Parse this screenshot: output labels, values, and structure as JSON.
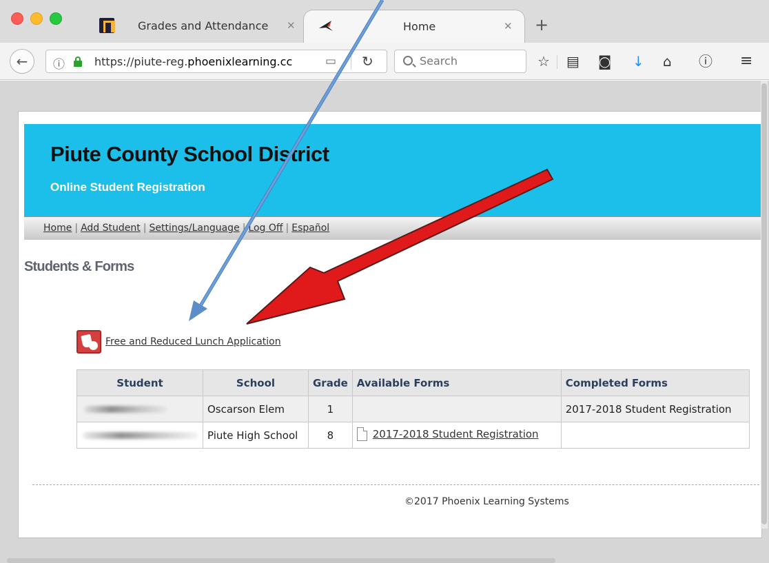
{
  "browser": {
    "tabs": [
      {
        "title": "Grades and Attendance",
        "close": "✕"
      },
      {
        "title": "Home",
        "close": "✕"
      }
    ],
    "new_tab": "+",
    "url_host_prefix": "https://piute-reg.",
    "url_host_main": "phoenixlearning.cc",
    "search_placeholder": "Search"
  },
  "site": {
    "title": "Piute County School District",
    "subtitle": "Online Student Registration",
    "menu": [
      "Home",
      "Add Student",
      "Settings/Language",
      "Log Off",
      "Español"
    ]
  },
  "section_title": "Students & Forms",
  "lunch_link": "Free and Reduced Lunch Application",
  "table": {
    "headers": [
      "Student",
      "School",
      "Grade",
      "Available Forms",
      "Completed Forms"
    ],
    "rows": [
      {
        "school": "Oscarson Elem",
        "grade": "1",
        "available": "",
        "completed": "2017-2018 Student Registration"
      },
      {
        "school": "Piute High School",
        "grade": "8",
        "available": "2017-2018 Student Registration",
        "completed": ""
      }
    ]
  },
  "footer": "©2017 Phoenix Learning Systems",
  "colors": {
    "banner": "#1cbfea",
    "blue_arrow": "#5b8ec9",
    "red_arrow": "#e01a1a"
  }
}
